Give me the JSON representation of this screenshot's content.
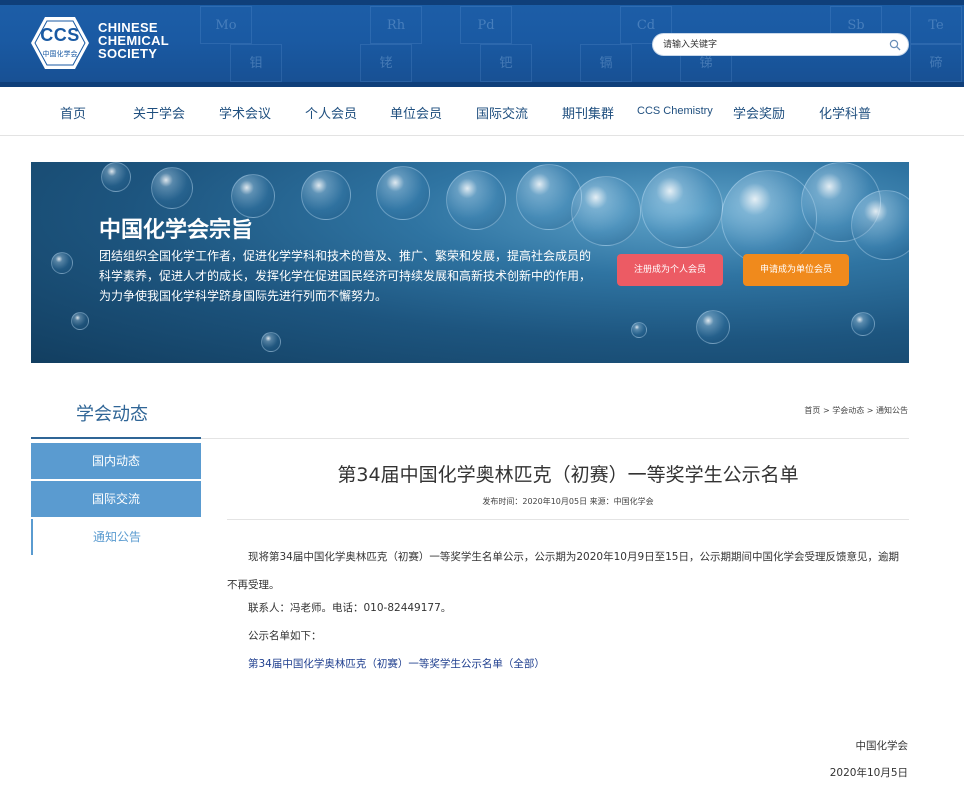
{
  "header": {
    "logo_abbr": "CCS",
    "logo_sub": "中国化学会",
    "brand_line1": "CHINESE",
    "brand_line2": "CHEMICAL",
    "brand_line3": "SOCIETY",
    "background_color": "#1a5aa3",
    "periodic_symbols": [
      "Mo",
      "Rh",
      "Pd",
      "Cd",
      "Sb",
      "Te",
      "钼",
      "铑",
      "钯",
      "镉",
      "锑",
      "碲"
    ]
  },
  "search": {
    "placeholder": "请输入关键字",
    "icon": "search-icon"
  },
  "nav": {
    "items": [
      "首页",
      "关于学会",
      "学术会议",
      "个人会员",
      "单位会员",
      "国际交流",
      "期刊集群",
      "CCS Chemistry",
      "学会奖励",
      "化学科普"
    ]
  },
  "banner": {
    "title": "中国化学会宗旨",
    "text": "团结组织全国化学工作者，促进化学学科和技术的普及、推广、繁荣和发展，提高社会成员的科学素养，促进人才的成长，发挥化学在促进国民经济可持续发展和高新技术创新中的作用，为力争使我国化学科学跻身国际先进行列而不懈努力。",
    "btn_person": "注册成为个人会员",
    "btn_unit": "申请成为单位会员",
    "btn_person_color": "#ec5b64",
    "btn_unit_color": "#f08a1c"
  },
  "section": {
    "title": "学会动态",
    "accent_color": "#2f6596"
  },
  "breadcrumb": {
    "home": "首页",
    "sep1": " > ",
    "level1": "学会动态",
    "sep2": " > ",
    "level2": "通知公告"
  },
  "sidebar": {
    "items": [
      {
        "label": "国内动态",
        "active": false
      },
      {
        "label": "国际交流",
        "active": false
      },
      {
        "label": "通知公告",
        "active": true
      }
    ],
    "color": "#5a9bd0"
  },
  "article": {
    "title": "第34届中国化学奥林匹克（初赛）一等奖学生公示名单",
    "meta": "发布时间：2020年10月05日 来源：中国化学会",
    "para1": "现将第34届中国化学奥林匹克（初赛）一等奖学生名单公示，公示期为2020年10月9日至15日，公示期期间中国化学会受理反馈意见，逾期不再受理。",
    "contact": "联系人：冯老师。电话：010-82449177。",
    "list_intro": "公示名单如下：",
    "list_link": "第34届中国化学奥林匹克（初赛）一等奖学生公示名单（全部）",
    "sign_org": "中国化学会",
    "sign_date": "2020年10月5日"
  }
}
